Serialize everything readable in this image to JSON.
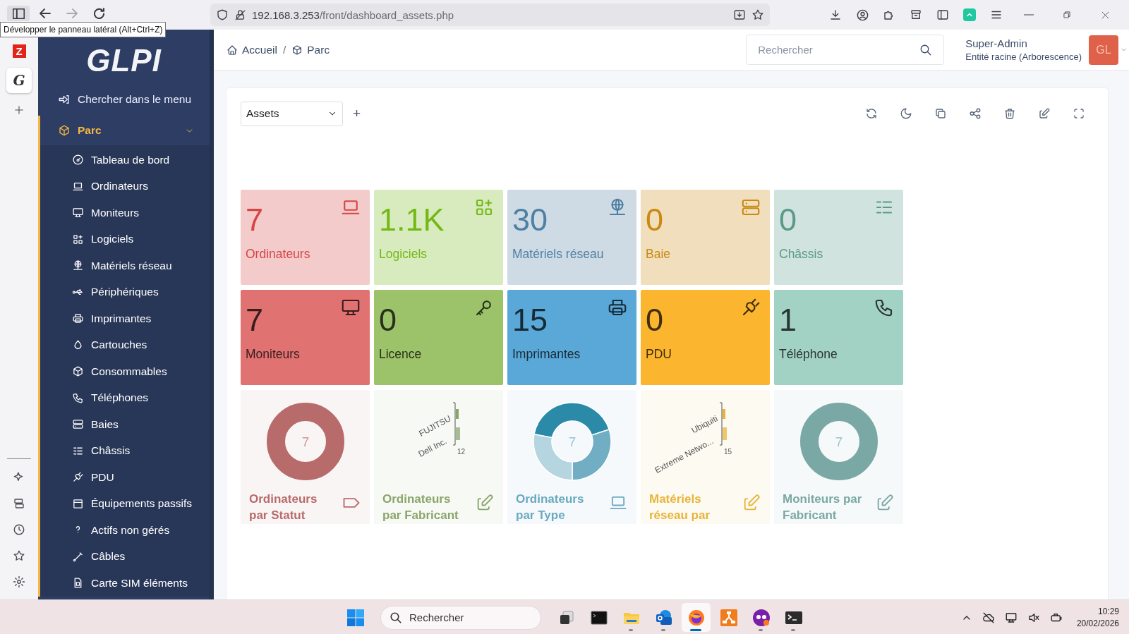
{
  "browser": {
    "tooltip": "Développer le panneau latéral (Alt+Ctrl+Z)",
    "url_host": "192.168.3.253",
    "url_path": "/front/dashboard_assets.php"
  },
  "browser_rail": {
    "items": [
      {
        "glyph": "Z",
        "selected": false
      },
      {
        "glyph": "G",
        "selected": true
      }
    ]
  },
  "sidebar": {
    "logo": "GLPI",
    "search_label": "Chercher dans le menu",
    "section": {
      "label": "Parc",
      "expanded": true
    },
    "items": [
      {
        "label": "Tableau de bord"
      },
      {
        "label": "Ordinateurs"
      },
      {
        "label": "Moniteurs"
      },
      {
        "label": "Logiciels"
      },
      {
        "label": "Matériels réseau"
      },
      {
        "label": "Périphériques"
      },
      {
        "label": "Imprimantes"
      },
      {
        "label": "Cartouches"
      },
      {
        "label": "Consommables"
      },
      {
        "label": "Téléphones"
      },
      {
        "label": "Baies"
      },
      {
        "label": "Châssis"
      },
      {
        "label": "PDU"
      },
      {
        "label": "Équipements passifs"
      },
      {
        "label": "Actifs non gérés"
      },
      {
        "label": "Câbles"
      },
      {
        "label": "Carte SIM éléments"
      }
    ]
  },
  "header": {
    "breadcrumbs": [
      "Accueil",
      "Parc"
    ],
    "breadcrumb_separator": "/",
    "search_placeholder": "Rechercher",
    "user": "Super-Admin",
    "entity": "Entité racine (Arborescence)",
    "avatar": "GL"
  },
  "dashboard": {
    "selector": "Assets",
    "add": "+",
    "stat_cards": [
      {
        "kind": "pale",
        "value": "7",
        "label": "Ordinateurs",
        "color": "#d64545"
      },
      {
        "kind": "pale",
        "value": "1.1K",
        "label": "Logiciels",
        "color": "#74b816"
      },
      {
        "kind": "pale",
        "value": "30",
        "label": "Matériels réseau",
        "color": "#4f7fa3"
      },
      {
        "kind": "pale",
        "value": "0",
        "label": "Baie",
        "color": "#c98a12"
      },
      {
        "kind": "pale",
        "value": "0",
        "label": "Châssis",
        "color": "#5a9a88"
      },
      {
        "kind": "solid",
        "value": "7",
        "label": "Moniteurs",
        "color": "#e07272"
      },
      {
        "kind": "solid",
        "value": "0",
        "label": "Licence",
        "color": "#9cc26a"
      },
      {
        "kind": "solid",
        "value": "15",
        "label": "Imprimantes",
        "color": "#5aa8d8"
      },
      {
        "kind": "solid",
        "value": "0",
        "label": "PDU",
        "color": "#fbb52e"
      },
      {
        "kind": "solid",
        "value": "1",
        "label": "Téléphone",
        "color": "#a2d2c3"
      }
    ],
    "chart_cards": [
      {
        "kind": "donut",
        "title": "Ordinateurs par Statut",
        "center": "7",
        "color": "#b86b6b"
      },
      {
        "kind": "bars",
        "title": "Ordinateurs par Fabricant",
        "labels": [
          "FUJITSU",
          "Dell Inc."
        ],
        "tick": "12",
        "color": "#8aa56b"
      },
      {
        "kind": "donut",
        "title": "Ordinateurs par Type",
        "center": "7",
        "color": "#6aaac0"
      },
      {
        "kind": "bars",
        "title": "Matériels réseau par",
        "labels": [
          "Ubiquiti",
          "Extreme Netwo..."
        ],
        "tick": "15",
        "color": "#e8b43a"
      },
      {
        "kind": "donut",
        "title": "Moniteurs par Fabricant",
        "center": "7",
        "color": "#7aa8a5"
      }
    ]
  },
  "taskbar": {
    "search_placeholder": "Rechercher",
    "apps": [
      {
        "running": false,
        "selected": false
      },
      {
        "running": false,
        "selected": false
      },
      {
        "running": true,
        "selected": false
      },
      {
        "running": true,
        "selected": false
      },
      {
        "running": true,
        "selected": true
      },
      {
        "running": false,
        "selected": false
      },
      {
        "running": true,
        "selected": false
      },
      {
        "running": true,
        "selected": false
      }
    ],
    "time": "10:29",
    "date": "20/02/2026"
  }
}
